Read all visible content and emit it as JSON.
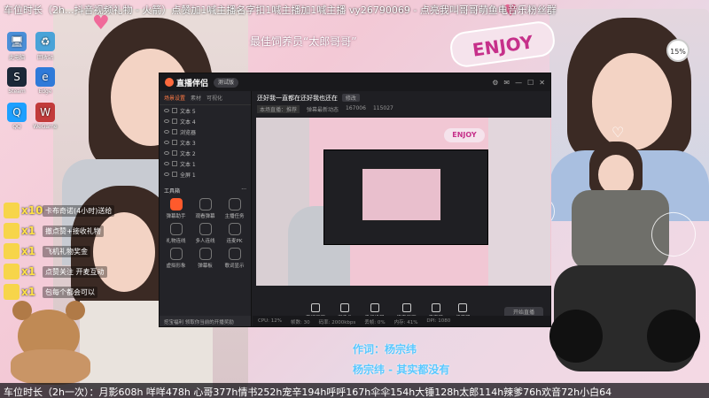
{
  "ticker": "车位时长（2h...抖音视频礼物 - 火箭）点赞加1喊主播名字扣1喊主播加1喊主播 vy26790069 - 点亮我叫哥哥萌鱼电音乐粉丝群",
  "overlay_title": "最佳饲养员“太郎哥哥”",
  "enjoy_text": "ENJOY",
  "fps_text": "15%",
  "desktop_icons": [
    {
      "label": "此电脑",
      "icon": "pc-icon"
    },
    {
      "label": "回收站",
      "icon": "recycle-icon"
    },
    {
      "label": "Steam",
      "icon": "steam-icon"
    },
    {
      "label": "Edge",
      "icon": "edge-icon"
    },
    {
      "label": "QQ",
      "icon": "qq-icon"
    },
    {
      "label": "WeGame",
      "icon": "game-icon"
    }
  ],
  "gifts": [
    {
      "count": "x10",
      "text": "卡布奇诺(4小时)送给"
    },
    {
      "count": "x1",
      "text": "撤点赞+接收礼物"
    },
    {
      "count": "x1",
      "text": "飞机礼物奖金"
    },
    {
      "count": "x1",
      "text": "点赞关注 开麦互动"
    },
    {
      "count": "x1",
      "text": "包每个都会可以"
    }
  ],
  "app": {
    "logo": "直播伴侣",
    "version_pill": "测试版",
    "left_tabs": [
      "场景设置",
      "素材",
      "可视化"
    ],
    "scenes": [
      "文本 5",
      "文本 4",
      "浏览器",
      "文本 3",
      "文本 2",
      "文本 1",
      "全屏 1"
    ],
    "tools_header": "工具箱",
    "tools_more": "···",
    "tools": [
      {
        "label": "弹幕助手",
        "highlight": true
      },
      {
        "label": "观看弹幕",
        "highlight": false
      },
      {
        "label": "主播任务",
        "highlight": false
      },
      {
        "label": "礼物连线",
        "highlight": false
      },
      {
        "label": "多人连线",
        "highlight": false
      },
      {
        "label": "连麦PK",
        "highlight": false
      },
      {
        "label": "虚拟形象",
        "highlight": false
      },
      {
        "label": "弹幕板",
        "highlight": false
      },
      {
        "label": "歌词显示",
        "highlight": false
      }
    ],
    "left_footer": "挖宝福利  领取你当前的开播奖励",
    "stream_title": "还好我一直都在还好我也还在",
    "title_tag": "修改",
    "sub_info": [
      "本场直播：推荐",
      "弹幕最新动态",
      "167006",
      "115027"
    ],
    "controls": [
      "直播画面",
      "摄像头",
      "手机投屏",
      "语音画面",
      "麦克风",
      "扬声器"
    ],
    "go_live": "开始直播",
    "status": [
      "CPU: 12%",
      "帧数: 30",
      "码率: 2000kbps",
      "丢帧: 0%",
      "内存: 41%",
      "DPI: 1080"
    ]
  },
  "lyrics_line1": "作词：杨宗纬",
  "lyrics_line2": "杨宗纬 - 其实都没有",
  "bottom_bar": "车位时长（2h一次）：月影608h  咩咩478h  心哥377h情书252h宠辛194h呼呼167h伞伞154h大锤128h太郎114h辣爹76h欢音72h小白64"
}
